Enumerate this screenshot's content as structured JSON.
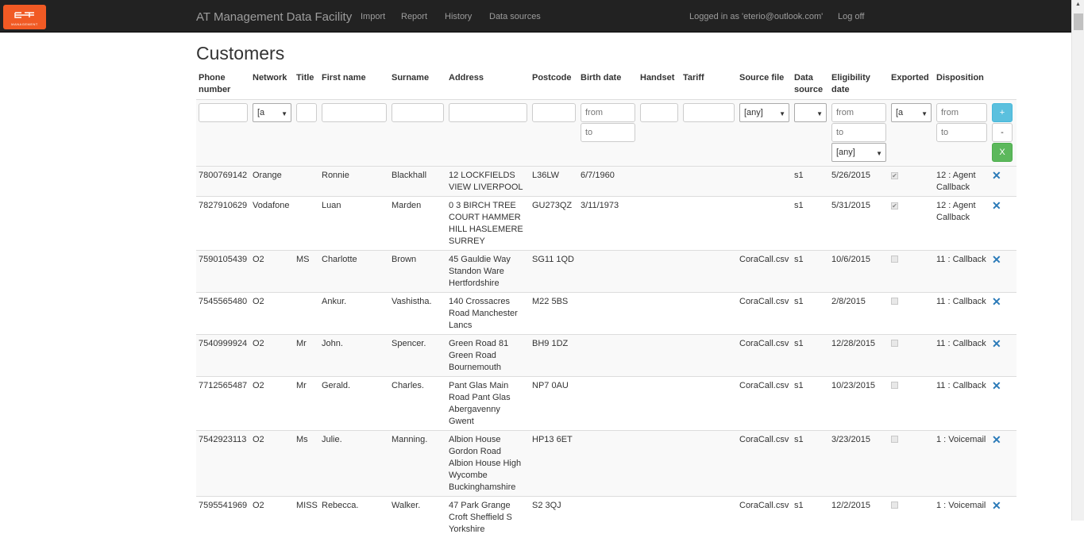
{
  "navbar": {
    "logo_text": "MANAGEMENT",
    "brand": "AT Management Data Facility",
    "links": [
      "Import",
      "Report",
      "History",
      "Data sources"
    ],
    "logged_in": "Logged in as 'eterio@outlook.com'",
    "logout": "Log off"
  },
  "page": {
    "title": "Customers"
  },
  "table": {
    "headers": {
      "phone": "Phone number",
      "network": "Network",
      "title": "Title",
      "first": "First name",
      "surname": "Surname",
      "address": "Address",
      "postcode": "Postcode",
      "birth": "Birth date",
      "handset": "Handset",
      "tariff": "Tariff",
      "source_file": "Source file",
      "data_source": "Data source",
      "eligibility": "Eligibility date",
      "exported": "Exported",
      "disposition": "Disposition"
    },
    "filters": {
      "network_select": "[a",
      "birth_from": "from",
      "birth_to": "to",
      "source_file_select": "[any]",
      "data_source_select": "",
      "elig_from": "from",
      "elig_to": "to",
      "elig_select": "[any]",
      "exported_select": "[a",
      "disp_from": "from",
      "disp_to": "to",
      "plus": "+",
      "minus": "-",
      "clear": "X"
    },
    "rows": [
      {
        "phone": "7800769142",
        "network": "Orange",
        "title": "",
        "first": "Ronnie",
        "surname": "Blackhall",
        "address": "12 LOCKFIELDS VIEW LIVERPOOL",
        "postcode": "L36LW",
        "birth": "6/7/1960",
        "handset": "",
        "tariff": "",
        "source_file": "",
        "data_source": "s1",
        "eligibility": "5/26/2015",
        "exported": true,
        "disposition": "12 : Agent Callback"
      },
      {
        "phone": "7827910629",
        "network": "Vodafone",
        "title": "",
        "first": "Luan",
        "surname": "Marden",
        "address": "0 3 BIRCH TREE COURT HAMMER HILL HASLEMERE SURREY",
        "postcode": "GU273QZ",
        "birth": "3/11/1973",
        "handset": "",
        "tariff": "",
        "source_file": "",
        "data_source": "s1",
        "eligibility": "5/31/2015",
        "exported": true,
        "disposition": "12 : Agent Callback"
      },
      {
        "phone": "7590105439",
        "network": "O2",
        "title": "MS",
        "first": "Charlotte",
        "surname": "Brown",
        "address": "45 Gauldie Way Standon Ware Hertfordshire",
        "postcode": "SG11 1QD",
        "birth": "",
        "handset": "",
        "tariff": "",
        "source_file": "CoraCall.csv",
        "data_source": "s1",
        "eligibility": "10/6/2015",
        "exported": false,
        "disposition": "11 : Callback"
      },
      {
        "phone": "7545565480",
        "network": "O2",
        "title": "",
        "first": "Ankur.",
        "surname": "Vashistha.",
        "address": "140 Crossacres Road Manchester Lancs",
        "postcode": "M22 5BS",
        "birth": "",
        "handset": "",
        "tariff": "",
        "source_file": "CoraCall.csv",
        "data_source": "s1",
        "eligibility": "2/8/2015",
        "exported": false,
        "disposition": "11 : Callback"
      },
      {
        "phone": "7540999924",
        "network": "O2",
        "title": "Mr",
        "first": "John.",
        "surname": "Spencer.",
        "address": "Green Road 81 Green Road Bournemouth",
        "postcode": "BH9 1DZ",
        "birth": "",
        "handset": "",
        "tariff": "",
        "source_file": "CoraCall.csv",
        "data_source": "s1",
        "eligibility": "12/28/2015",
        "exported": false,
        "disposition": "11 : Callback"
      },
      {
        "phone": "7712565487",
        "network": "O2",
        "title": "Mr",
        "first": "Gerald.",
        "surname": "Charles.",
        "address": "Pant Glas Main Road Pant Glas Abergavenny Gwent",
        "postcode": "NP7 0AU",
        "birth": "",
        "handset": "",
        "tariff": "",
        "source_file": "CoraCall.csv",
        "data_source": "s1",
        "eligibility": "10/23/2015",
        "exported": false,
        "disposition": "11 : Callback"
      },
      {
        "phone": "7542923113",
        "network": "O2",
        "title": "Ms",
        "first": "Julie.",
        "surname": "Manning.",
        "address": "Albion House Gordon Road Albion House High Wycombe Buckinghamshire",
        "postcode": "HP13 6ET",
        "birth": "",
        "handset": "",
        "tariff": "",
        "source_file": "CoraCall.csv",
        "data_source": "s1",
        "eligibility": "3/23/2015",
        "exported": false,
        "disposition": "1 : Voicemail"
      },
      {
        "phone": "7595541969",
        "network": "O2",
        "title": "MISS",
        "first": "Rebecca.",
        "surname": "Walker.",
        "address": "47 Park Grange Croft Sheffield S Yorkshire",
        "postcode": "S2 3QJ",
        "birth": "",
        "handset": "",
        "tariff": "",
        "source_file": "CoraCall.csv",
        "data_source": "s1",
        "eligibility": "12/2/2015",
        "exported": false,
        "disposition": "1 : Voicemail"
      }
    ],
    "delete_glyph": "✕"
  }
}
